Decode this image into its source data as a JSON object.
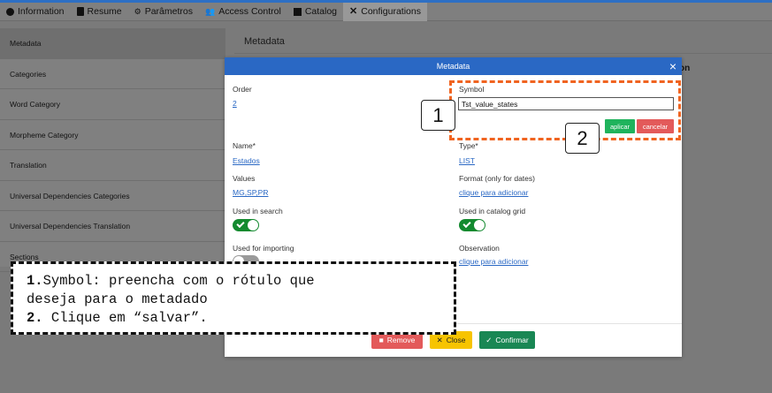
{
  "tabs": [
    {
      "label": "Information",
      "icon": "info-icon"
    },
    {
      "label": "Resume",
      "icon": "document-icon"
    },
    {
      "label": "Parâmetros",
      "icon": "settings-icon"
    },
    {
      "label": "Access Control",
      "icon": "users-icon"
    },
    {
      "label": "Catalog",
      "icon": "book-icon"
    },
    {
      "label": "Configurations",
      "icon": "tools-icon"
    }
  ],
  "sidebar": {
    "items": [
      {
        "label": "Metadata"
      },
      {
        "label": "Categories"
      },
      {
        "label": "Word Category"
      },
      {
        "label": "Morpheme Category"
      },
      {
        "label": "Translation"
      },
      {
        "label": "Universal Dependencies Categories"
      },
      {
        "label": "Universal Dependencies Translation"
      },
      {
        "label": "Sections"
      }
    ]
  },
  "background": {
    "title": "Metadata",
    "column_fragment": "on"
  },
  "modal": {
    "title": "Metadata",
    "close": "×",
    "order": {
      "label": "Order",
      "value": "2"
    },
    "symbol": {
      "label": "Symbol",
      "value": "Tst_value_states"
    },
    "apply_label": "aplicar",
    "cancel_label": "cancelar",
    "name": {
      "label": "Name*",
      "value": "Estados"
    },
    "type": {
      "label": "Type*",
      "value": "LIST"
    },
    "values": {
      "label": "Values",
      "value": "MG,SP,PR"
    },
    "format": {
      "label": "Format (only for dates)",
      "value": "clique para adicionar"
    },
    "used_in_search": {
      "label": "Used in search",
      "on": true
    },
    "used_in_catalog_grid": {
      "label": "Used in catalog grid",
      "on": true
    },
    "used_for_importing": {
      "label": "Used for importing",
      "on": false
    },
    "observation": {
      "label": "Observation",
      "value": "clique para adicionar"
    },
    "remove_label": "Remove",
    "close_label": "Close",
    "confirm_label": "Confirmar"
  },
  "annotations": {
    "marker_1": "1",
    "marker_2": "2",
    "note_num_1": "1.",
    "note_line_1": "Symbol: preencha com o rótulo que",
    "note_line_2": "deseja para o metadado",
    "note_num_2": "2.",
    "note_line_3": " Clique em “salvar”.",
    "dash_color": "#f06420"
  }
}
